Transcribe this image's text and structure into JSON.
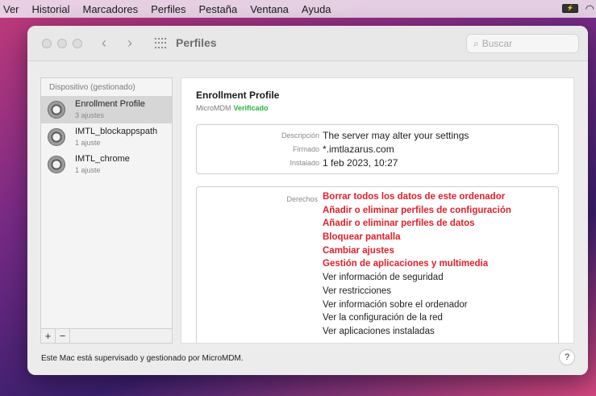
{
  "menubar": {
    "items": [
      "Ver",
      "Historial",
      "Marcadores",
      "Perfiles",
      "Pestaña",
      "Ventana",
      "Ayuda"
    ]
  },
  "window": {
    "title": "Perfiles",
    "search_placeholder": "Buscar"
  },
  "sidebar": {
    "header": "Dispositivo (gestionado)",
    "items": [
      {
        "name": "Enrollment Profile",
        "sub": "3 ajustes",
        "selected": true
      },
      {
        "name": "IMTL_blockappspath",
        "sub": "1 ajuste",
        "selected": false
      },
      {
        "name": "IMTL_chrome",
        "sub": "1 ajuste",
        "selected": false
      }
    ],
    "add_label": "+",
    "remove_label": "−"
  },
  "profile": {
    "title": "Enrollment Profile",
    "source": "MicroMDM",
    "status": "Verificado",
    "details": [
      {
        "label": "Descripción",
        "value": "The server may alter your settings"
      },
      {
        "label": "Firmado",
        "value": "*.imtlazarus.com"
      },
      {
        "label": "Instalado",
        "value": "1 feb 2023, 10:27"
      }
    ],
    "rights_label": "Derechos",
    "rights": [
      {
        "text": "Borrar todos los datos de este ordenador",
        "highlight": true
      },
      {
        "text": "Añadir o eliminar perfiles de configuración",
        "highlight": true
      },
      {
        "text": "Añadir o eliminar perfiles de datos",
        "highlight": true
      },
      {
        "text": "Bloquear pantalla",
        "highlight": true
      },
      {
        "text": "Cambiar ajustes",
        "highlight": true
      },
      {
        "text": "Gestión de aplicaciones y multimedia",
        "highlight": true
      },
      {
        "text": "Ver información de seguridad",
        "highlight": false
      },
      {
        "text": "Ver restricciones",
        "highlight": false
      },
      {
        "text": "Ver información sobre el ordenador",
        "highlight": false
      },
      {
        "text": "Ver la configuración de la red",
        "highlight": false
      },
      {
        "text": "Ver aplicaciones instaladas",
        "highlight": false
      }
    ],
    "colors": {
      "highlight": "#e0202a",
      "verified": "#28b441"
    }
  },
  "footer": {
    "text": "Este Mac está supervisado y gestionado por MicroMDM.",
    "help_label": "?"
  }
}
